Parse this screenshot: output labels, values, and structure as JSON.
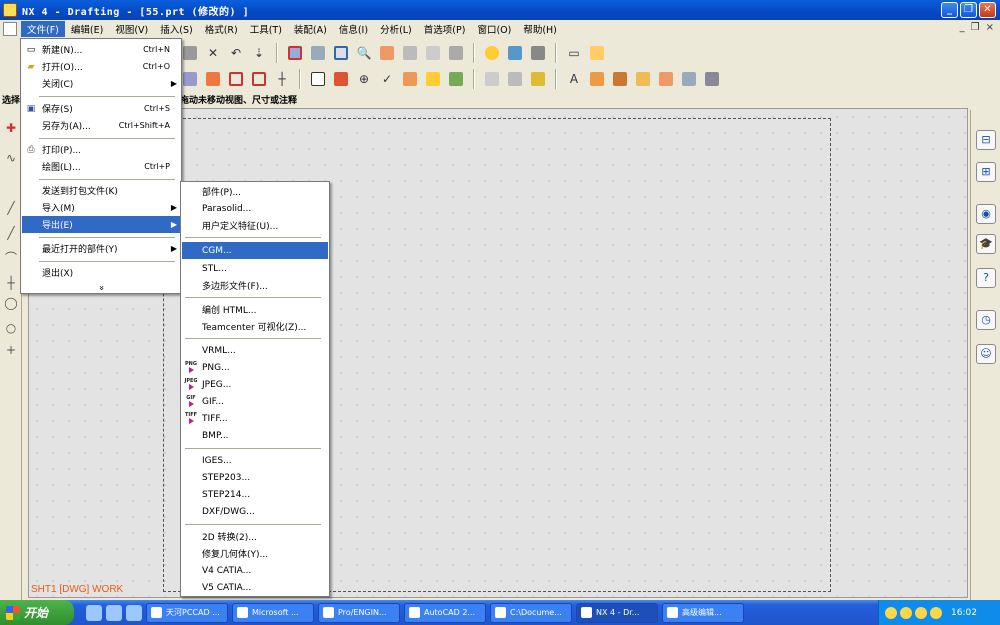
{
  "window": {
    "title": "NX 4 - Drafting - [55.prt  (修改的) ]",
    "minimize": "_",
    "maximize": "❐",
    "close": "✕"
  },
  "menubar": {
    "items": [
      "文件(F)",
      "编辑(E)",
      "视图(V)",
      "插入(S)",
      "格式(R)",
      "工具(T)",
      "装配(A)",
      "信息(I)",
      "分析(L)",
      "首选项(P)",
      "窗口(O)",
      "帮助(H)"
    ],
    "mdi_controls": [
      "_",
      "❐",
      "×"
    ]
  },
  "cue_line": {
    "left": "选择",
    "text": "拖动未移动视图、尺寸或注释"
  },
  "file_menu": {
    "items": [
      {
        "label": "新建(N)...",
        "shortcut": "Ctrl+N",
        "icon": "new-file-icon",
        "glyph": "▭"
      },
      {
        "label": "打开(O)...",
        "shortcut": "Ctrl+O",
        "icon": "open-folder-icon",
        "glyph": "📂"
      },
      {
        "label": "关闭(C)",
        "shortcut": "",
        "icon": "",
        "glyph": "",
        "submenu": true
      },
      {
        "label": "保存(S)",
        "shortcut": "Ctrl+S",
        "icon": "save-icon",
        "glyph": "💾"
      },
      {
        "label": "另存为(A)...",
        "shortcut": "Ctrl+Shift+A",
        "icon": "",
        "glyph": ""
      },
      {
        "label": "打印(P)...",
        "shortcut": "",
        "icon": "print-icon",
        "glyph": "⎙"
      },
      {
        "label": "绘图(L)...",
        "shortcut": "Ctrl+P",
        "icon": "",
        "glyph": ""
      },
      {
        "label": "发送到打包文件(K)",
        "shortcut": "",
        "icon": "",
        "glyph": ""
      },
      {
        "label": "导入(M)",
        "shortcut": "",
        "icon": "",
        "glyph": "",
        "submenu": true
      },
      {
        "label": "导出(E)",
        "shortcut": "",
        "icon": "",
        "glyph": "",
        "submenu": true,
        "highlighted": true
      },
      {
        "label": "最近打开的部件(Y)",
        "shortcut": "",
        "icon": "",
        "glyph": "",
        "submenu": true
      },
      {
        "label": "退出(X)",
        "shortcut": "",
        "icon": "",
        "glyph": ""
      }
    ],
    "expand": "»"
  },
  "export_menu": {
    "items": [
      {
        "label": "部件(P)..."
      },
      {
        "label": "Parasolid..."
      },
      {
        "label": "用户定义特征(U)..."
      },
      {
        "label": "CGM...",
        "highlighted": true
      },
      {
        "label": "STL..."
      },
      {
        "label": "多边形文件(F)..."
      },
      {
        "label": "编创 HTML..."
      },
      {
        "label": "Teamcenter 可视化(Z)..."
      },
      {
        "label": "VRML..."
      },
      {
        "label": "PNG...",
        "tag": "PNG"
      },
      {
        "label": "JPEG...",
        "tag": "JPEG"
      },
      {
        "label": "GIF...",
        "tag": "GIF"
      },
      {
        "label": "TIFF...",
        "tag": "TIFF"
      },
      {
        "label": "BMP..."
      },
      {
        "label": "IGES..."
      },
      {
        "label": "STEP203..."
      },
      {
        "label": "STEP214..."
      },
      {
        "label": "DXF/DWG..."
      },
      {
        "label": "2D 转换(2)..."
      },
      {
        "label": "修复几何体(Y)..."
      },
      {
        "label": "V4 CATIA..."
      },
      {
        "label": "V5 CATIA..."
      }
    ]
  },
  "sheet": {
    "label": "SHT1 [DWG] WORK"
  },
  "taskbar": {
    "start": "开始",
    "tasks": [
      "天河PCCAD ...",
      "Microsoft ...",
      "Pro/ENGIN...",
      "AutoCAD 2...",
      "C:\\Docume...",
      "NX 4 - Dr...",
      "高级编辑..."
    ],
    "active_task": 5,
    "clock": "16:02"
  },
  "colors": {
    "title_bar": "#0649c6",
    "menu_highlight": "#316ac5",
    "canvas": "#e3e3e3",
    "sheet_label": "#e85a12",
    "taskbar": "#245edb"
  }
}
